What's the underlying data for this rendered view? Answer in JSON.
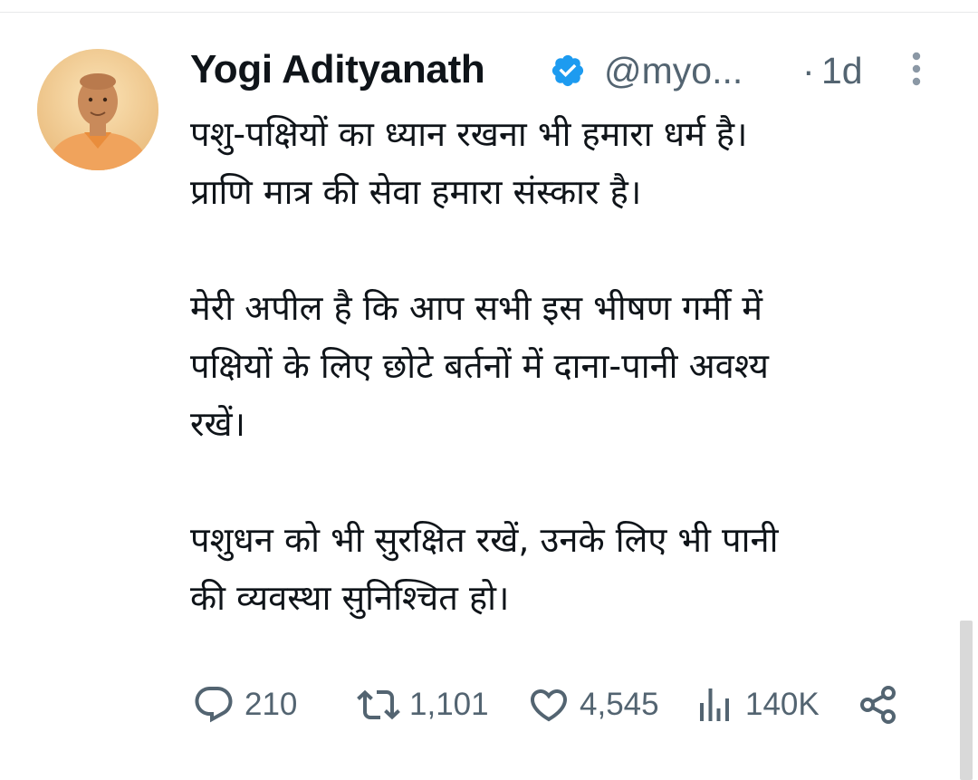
{
  "tweet": {
    "author": {
      "display_name": "Yogi Adityanath",
      "handle": "@myo...",
      "verified_icon": "verified-badge-icon",
      "avatar_icon": "profile-photo"
    },
    "separator": "·",
    "time": "1d",
    "more_icon": "more-vertical-icon",
    "text_lines": [
      "पशु-पक्षियों का ध्यान रखना भी हमारा धर्म है।",
      "प्राणि मात्र की सेवा हमारा संस्कार है।",
      "",
      "मेरी अपील है कि आप सभी इस भीषण गर्मी में",
      "पक्षियों के लिए छोटे बर्तनों में दाना-पानी अवश्य",
      "रखें।",
      "",
      "पशुधन को भी सुरक्षित रखें, उनके लिए भी पानी",
      "की व्यवस्था सुनिश्चित हो।"
    ],
    "actions": {
      "reply": {
        "count": "210",
        "icon": "reply-icon"
      },
      "retweet": {
        "count": "1,101",
        "icon": "retweet-icon"
      },
      "like": {
        "count": "4,545",
        "icon": "heart-icon"
      },
      "views": {
        "count": "140K",
        "icon": "views-icon"
      },
      "share": {
        "icon": "share-icon"
      }
    }
  },
  "colors": {
    "text": "#0f1419",
    "secondary": "#536471",
    "verified": "#1d9bf0",
    "divider": "#e7e9ea"
  }
}
